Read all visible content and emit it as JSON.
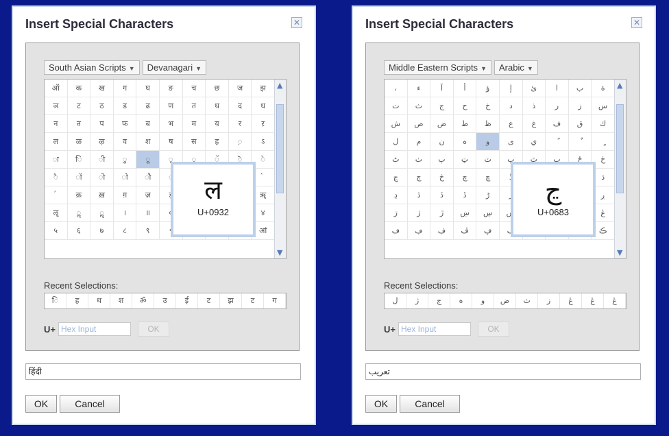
{
  "dialogs": [
    {
      "title": "Insert Special Characters",
      "category": "South Asian Scripts",
      "subcategory": "Devanagari",
      "highlight_index": 44,
      "grid": [
        "ऑ",
        "क",
        "ख",
        "ग",
        "घ",
        "ङ",
        "च",
        "छ",
        "ज",
        "झ",
        "ञ",
        "ट",
        "ठ",
        "ड",
        "ढ",
        "ण",
        "त",
        "थ",
        "द",
        "ध",
        "न",
        "ऩ",
        "प",
        "फ",
        "ब",
        "भ",
        "म",
        "य",
        "र",
        "ऱ",
        "ल",
        "ळ",
        "ऴ",
        "व",
        "श",
        "ष",
        "स",
        "ह",
        "़",
        "ऽ",
        "ा",
        "ि",
        "ी",
        "ु",
        "ू",
        "ृ",
        "ॄ",
        "ॅ",
        "ॆ",
        "े",
        "ै",
        "ॉ",
        "ॊ",
        "ो",
        "ौ",
        "्",
        "ॐ",
        "॑",
        "॒",
        "॓",
        "॔",
        "क़",
        "ख़",
        "ग़",
        "ज़",
        "ड़",
        "ढ़",
        "फ़",
        "य़",
        "ॠ",
        "ॡ",
        "ॢ",
        "ॣ",
        "।",
        "॥",
        "०",
        "१",
        "२",
        "३",
        "४",
        "५",
        "६",
        "७",
        "८",
        "९",
        "॰",
        "ॱ",
        "ॲ",
        "ॳ",
        "ॴ"
      ],
      "preview_char": "ल",
      "preview_code": "U+0932",
      "recent_label": "Recent Selections:",
      "recent": [
        "ि",
        "ह",
        "थ",
        "श",
        "ॐ",
        "उ",
        "ई",
        "ट",
        "झ",
        "ट",
        "ग"
      ],
      "hex_label": "U+",
      "hex_placeholder": "Hex Input",
      "hex_ok": "OK",
      "text_value": "हिंदी",
      "ok_label": "OK",
      "cancel_label": "Cancel",
      "close_glyph": "✕"
    },
    {
      "title": "Insert Special Characters",
      "category": "Middle Eastern Scripts",
      "subcategory": "Arabic",
      "highlight_index": 34,
      "grid": [
        "،",
        "ء",
        "آ",
        "أ",
        "ؤ",
        "إ",
        "ئ",
        "ا",
        "ب",
        "ة",
        "ت",
        "ث",
        "ج",
        "ح",
        "خ",
        "د",
        "ذ",
        "ر",
        "ز",
        "س",
        "ش",
        "ص",
        "ض",
        "ط",
        "ظ",
        "ع",
        "غ",
        "ف",
        "ق",
        "ك",
        "ل",
        "م",
        "ن",
        "ه",
        "و",
        "ى",
        "ي",
        "ً",
        "ٌ",
        "ٍ",
        "ٹ",
        "ٺ",
        "ٻ",
        "ټ",
        "ٽ",
        "پ",
        "ٿ",
        "ڀ",
        "ځ",
        "ڂ",
        "ڃ",
        "ڄ",
        "څ",
        "چ",
        "ڇ",
        "ڈ",
        "ډ",
        "ڊ",
        "ڋ",
        "ڌ",
        "ڍ",
        "ڎ",
        "ڏ",
        "ڐ",
        "ڑ",
        "ڒ",
        "ړ",
        "ڔ",
        "ڕ",
        "ږ",
        "ڗ",
        "ژ",
        "ڙ",
        "ښ",
        "ڛ",
        "ڜ",
        "ڝ",
        "ڞ",
        "ڟ",
        "ڠ",
        "ڡ",
        "ڢ",
        "ڣ",
        "ڤ",
        "ڥ",
        "ڦ",
        "ڧ",
        "ڨ",
        "ک",
        "ڪ"
      ],
      "preview_char": "ڃ",
      "preview_code": "U+0683",
      "recent_label": "Recent Selections:",
      "recent": [
        "ل",
        "ژ",
        "ج",
        "ه",
        "و",
        "ض",
        "ث",
        "ز",
        "ڠ",
        "ڠ",
        "ڠ"
      ],
      "hex_label": "U+",
      "hex_placeholder": "Hex Input",
      "hex_ok": "OK",
      "text_value": "تعريب",
      "ok_label": "OK",
      "cancel_label": "Cancel",
      "close_glyph": "✕"
    }
  ]
}
